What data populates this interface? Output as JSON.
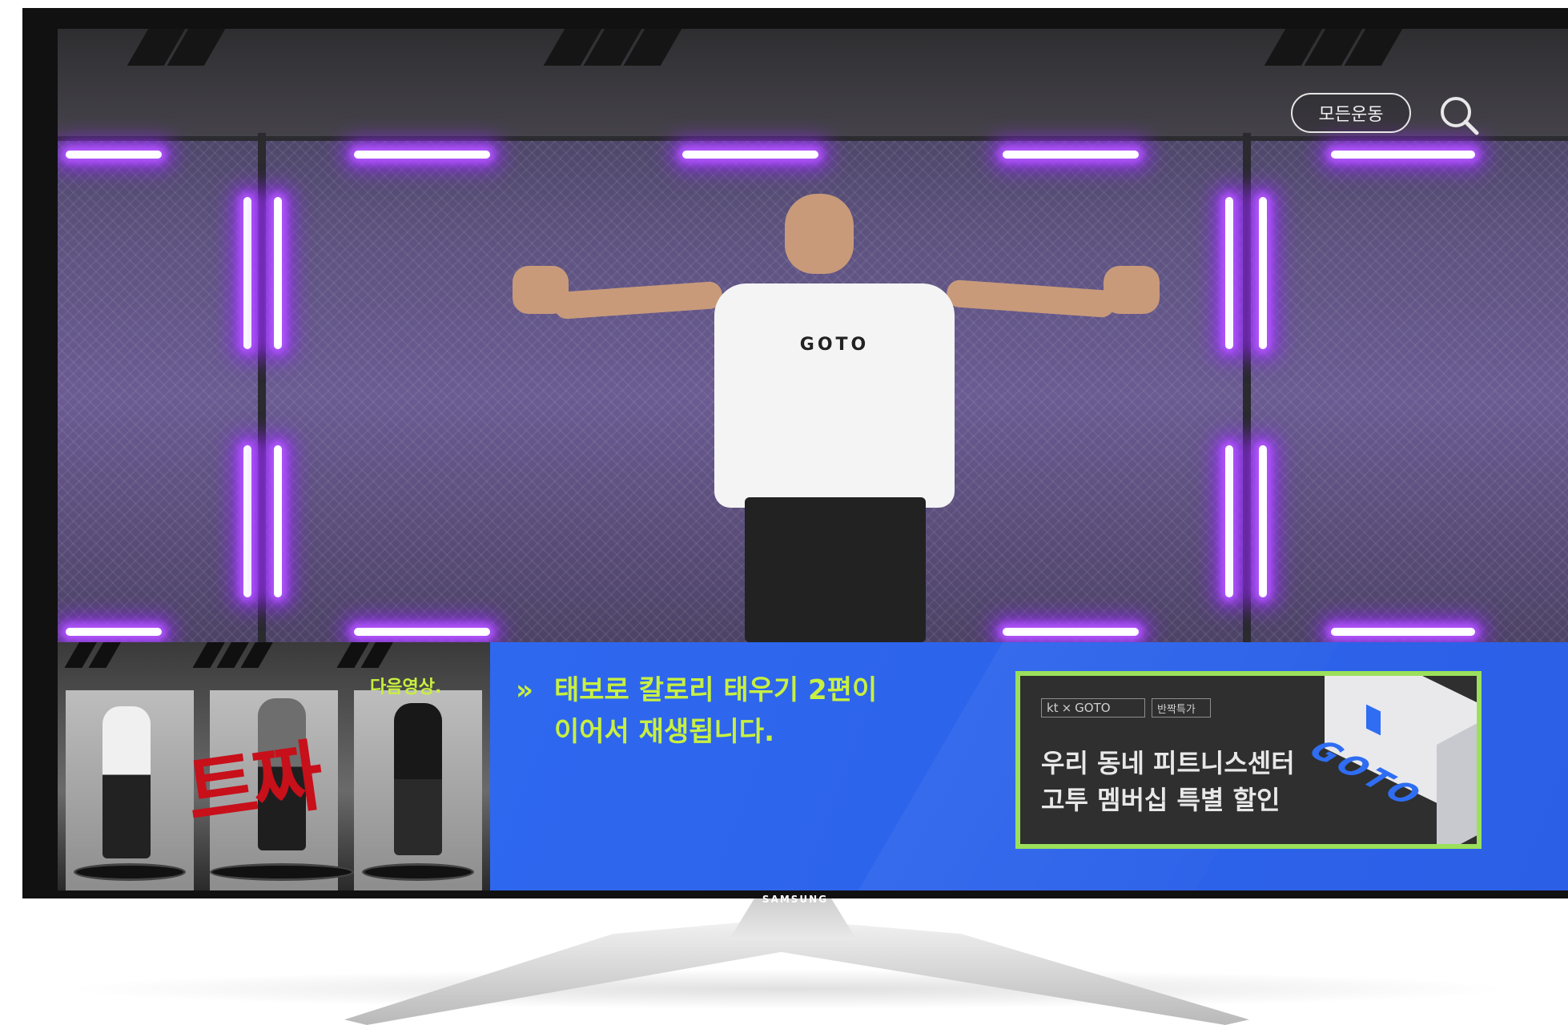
{
  "device": {
    "brand": "SAMSUNG"
  },
  "video": {
    "shirt_text": "GOTO"
  },
  "top_controls": {
    "all_exercise_label": "모든운동",
    "search_icon": "search-icon"
  },
  "next_up": {
    "label": "다음영상.",
    "brush_text": "트짜",
    "message_line1": "태보로 칼로리 태우기 2편이",
    "message_line2": "이어서 재생됩니다.",
    "chevron": "»"
  },
  "promo": {
    "brand_kt": "kt",
    "brand_x": "×",
    "brand_goto": "GOTO",
    "badge": "반짝특가",
    "headline_line1": "우리 동네 피트니스센터",
    "headline_line2": "고투 멤버십 특별 할인",
    "iso_text": "GOTO"
  },
  "colors": {
    "accent_green": "#c8f040",
    "bar_blue": "#2f6df2",
    "promo_border": "#9be05b",
    "neon_purple": "#b457ff"
  }
}
